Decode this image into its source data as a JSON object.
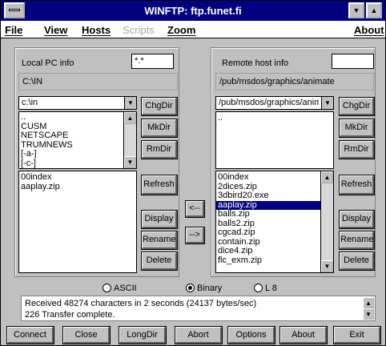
{
  "title": "WINFTP: ftp.funet.fi",
  "menu": {
    "file": "File",
    "view": "View",
    "hosts": "Hosts",
    "scripts": "Scripts",
    "zoom": "Zoom",
    "about": "About"
  },
  "local": {
    "info_label": "Local PC info",
    "filter": "*.*",
    "path": "C:\\IN",
    "dir_select": "c:\\in",
    "dirs": [
      "..",
      "CUSM",
      "NETSCAPE",
      "TRUMNEWS",
      "[-a-]",
      "[-c-]"
    ],
    "files": [
      "00index",
      "aaplay.zip"
    ]
  },
  "remote": {
    "info_label": "Remote host info",
    "filter": "",
    "path": "/pub/msdos/graphics/animate",
    "dir_select": "/pub/msdos/graphics/anim",
    "dirs": [
      ".."
    ],
    "files": [
      "00index",
      "2dices.zip",
      "3dbird20.exe",
      "aaplay.zip",
      "balls.zip",
      "balls2.zip",
      "cgcad.zip",
      "contain.zip",
      "dice4.zip",
      "flc_exm.zip"
    ],
    "selected_file": "aaplay.zip"
  },
  "buttons": {
    "chgdir": "ChgDir",
    "mkdir": "MkDir",
    "rmdir": "RmDir",
    "refresh": "Refresh",
    "display": "Display",
    "rename": "Rename",
    "delete": "Delete",
    "to_local": "<--",
    "to_remote": "-->"
  },
  "mode": {
    "ascii": "ASCII",
    "binary": "Binary",
    "l8": "L 8",
    "selected": "Binary"
  },
  "status_lines": [
    "Received 48274 characters in 2 seconds (24137 bytes/sec)",
    "226 Transfer complete."
  ],
  "bottom": {
    "connect": "Connect",
    "close": "Close",
    "longdir": "LongDir",
    "abort": "Abort",
    "options": "Options",
    "about": "About",
    "exit": "Exit"
  },
  "colors": {
    "titlebar": "#000080",
    "window": "#c0c0c0",
    "selection": "#000080"
  }
}
